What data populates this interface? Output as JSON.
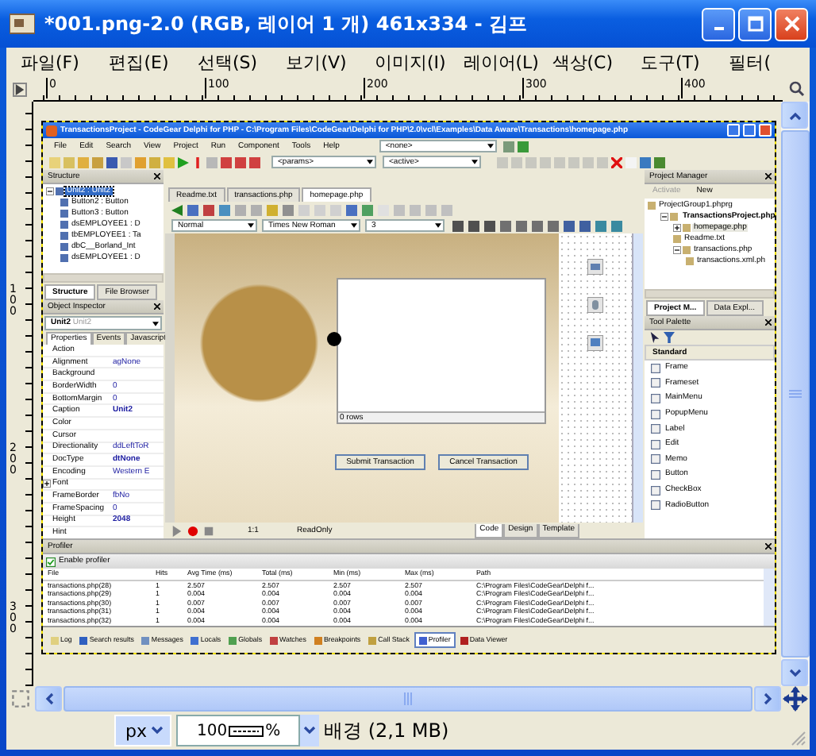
{
  "window": {
    "title": "*001.png-2.0 (RGB, 레이어 1 개) 461x334 - 김프"
  },
  "menu": [
    "파일(F)",
    "편집(E)",
    "선택(S)",
    "보기(V)",
    "이미지(I)",
    "레이어(L)",
    "색상(C)",
    "도구(T)",
    "필터("
  ],
  "rulers": {
    "horizontal": [
      "0",
      "100",
      "200",
      "300",
      "400"
    ],
    "vertical": [
      "100",
      "200",
      "300"
    ]
  },
  "ide": {
    "title": "TransactionsProject - CodeGear Delphi for PHP - C:\\Program Files\\CodeGear\\Delphi for PHP\\2.0\\vcl\\Examples\\Data Aware\\Transactions\\homepage.php",
    "menu": [
      "File",
      "Edit",
      "Search",
      "View",
      "Project",
      "Run",
      "Component",
      "Tools",
      "Help"
    ],
    "selectors": [
      "<none>",
      "<params>",
      "<active>"
    ],
    "structure": {
      "title": "Structure",
      "tree": [
        {
          "label": "Unit2 : Unit2",
          "selected": true,
          "expanded": true,
          "children": [
            {
              "label": "Button2 : Button",
              "selected": false
            },
            {
              "label": "Button3 : Button",
              "selected": false
            },
            {
              "label": "dsEMPLOYEE1 : D",
              "selected": false
            },
            {
              "label": "tbEMPLOYEE1 : Ta",
              "selected": false
            },
            {
              "label": "dbC__Borland_Int",
              "selected": false
            },
            {
              "label": "dsEMPLOYEE1 : D",
              "selected": false
            }
          ]
        }
      ]
    },
    "left_tabs": [
      {
        "label": "Structure",
        "selected": true
      },
      {
        "label": "File Browser",
        "selected": false
      }
    ],
    "inspector": {
      "title": "Object Inspector",
      "object": "Unit2",
      "object_type": "Unit2",
      "tabs": [
        {
          "label": "Properties",
          "selected": true
        },
        {
          "label": "Events",
          "selected": false
        },
        {
          "label": "Javascript",
          "selected": false
        }
      ],
      "properties": [
        {
          "name": "Action"
        },
        {
          "name": "Alignment",
          "value": "agNone",
          "modified": false
        },
        {
          "name": "Background"
        },
        {
          "name": "BorderWidth",
          "value": "0",
          "modified": false
        },
        {
          "name": "BottomMargin",
          "value": "0",
          "modified": false
        },
        {
          "name": "Caption",
          "value": "Unit2",
          "modified": true
        },
        {
          "name": "Color"
        },
        {
          "name": "Cursor"
        },
        {
          "name": "Directionality",
          "value": "ddLeftToR",
          "modified": false
        },
        {
          "name": "DocType",
          "value": "dtNone",
          "modified": true
        },
        {
          "name": "Encoding",
          "value": "Western E",
          "modified": false
        },
        {
          "name": "Font",
          "expanded": false
        },
        {
          "name": "FrameBorder",
          "value": "fbNo",
          "modified": false
        },
        {
          "name": "FrameSpacing",
          "value": "0",
          "modified": false
        },
        {
          "name": "Height",
          "value": "2048",
          "modified": true
        },
        {
          "name": "Hint"
        }
      ]
    },
    "editor_tabs": [
      {
        "label": "Readme.txt",
        "selected": false
      },
      {
        "label": "transactions.php",
        "selected": false
      },
      {
        "label": "homepage.php",
        "selected": true
      }
    ],
    "format": {
      "style": "Normal",
      "font": "Times New Roman",
      "size": "3"
    },
    "designer": {
      "grid_caption": "0 rows",
      "buttons": [
        "Submit Transaction",
        "Cancel Transaction"
      ]
    },
    "editor_status": {
      "position": "1:1",
      "mode": "ReadOnly"
    },
    "view_tabs": [
      {
        "label": "Code",
        "selected": true
      },
      {
        "label": "Design",
        "selected": false
      },
      {
        "label": "Template",
        "selected": false
      }
    ],
    "project_manager": {
      "title": "Project Manager",
      "actions": [
        {
          "label": "Activate",
          "disabled": true
        },
        {
          "label": "New",
          "disabled": false
        }
      ],
      "tree": [
        {
          "label": "ProjectGroup1.phprg",
          "selected": false,
          "children": [
            {
              "label": "TransactionsProject.php",
              "selected": false,
              "active": true,
              "expanded": true,
              "children": [
                {
                  "label": "homepage.php",
                  "selected": true,
                  "expanded": false
                },
                {
                  "label": "Readme.txt",
                  "selected": false
                },
                {
                  "label": "transactions.php",
                  "selected": false,
                  "expanded": true,
                  "children": [
                    {
                      "label": "transactions.xml.ph",
                      "selected": false
                    }
                  ]
                }
              ]
            }
          ]
        }
      ],
      "tabs": [
        {
          "label": "Project M...",
          "selected": true
        },
        {
          "label": "Data Expl...",
          "selected": false
        }
      ]
    },
    "tool_palette": {
      "title": "Tool Palette",
      "category": "Standard",
      "items": [
        "Frame",
        "Frameset",
        "MainMenu",
        "PopupMenu",
        "Label",
        "Edit",
        "Memo",
        "Button",
        "CheckBox",
        "RadioButton"
      ]
    },
    "profiler": {
      "title": "Profiler",
      "enable": {
        "label": "Enable profiler",
        "checked": true
      },
      "columns": [
        "File",
        "Hits",
        "Avg Time (ms)",
        "Total (ms)",
        "Min (ms)",
        "Max (ms)",
        "Path"
      ],
      "rows": [
        [
          "transactions.php(28)",
          "1",
          "2.507",
          "2.507",
          "2.507",
          "2.507",
          "C:\\Program Files\\CodeGear\\Delphi f..."
        ],
        [
          "transactions.php(29)",
          "1",
          "0.004",
          "0.004",
          "0.004",
          "0.004",
          "C:\\Program Files\\CodeGear\\Delphi f..."
        ],
        [
          "transactions.php(30)",
          "1",
          "0.007",
          "0.007",
          "0.007",
          "0.007",
          "C:\\Program Files\\CodeGear\\Delphi f..."
        ],
        [
          "transactions.php(31)",
          "1",
          "0.004",
          "0.004",
          "0.004",
          "0.004",
          "C:\\Program Files\\CodeGear\\Delphi f..."
        ],
        [
          "transactions.php(32)",
          "1",
          "0.004",
          "0.004",
          "0.004",
          "0.004",
          "C:\\Program Files\\CodeGear\\Delphi f..."
        ]
      ],
      "tabs": [
        {
          "label": "Log",
          "selected": false
        },
        {
          "label": "Search results",
          "selected": false
        },
        {
          "label": "Messages",
          "selected": false
        },
        {
          "label": "Locals",
          "selected": false
        },
        {
          "label": "Globals",
          "selected": false
        },
        {
          "label": "Watches",
          "selected": false
        },
        {
          "label": "Breakpoints",
          "selected": false
        },
        {
          "label": "Call Stack",
          "selected": false
        },
        {
          "label": "Profiler",
          "selected": true
        },
        {
          "label": "Data Viewer",
          "selected": false
        }
      ]
    }
  },
  "status_bar": {
    "unit": "px",
    "zoom": "100",
    "zoom_unit": "%",
    "info": "배경 (2,1 MB)"
  }
}
